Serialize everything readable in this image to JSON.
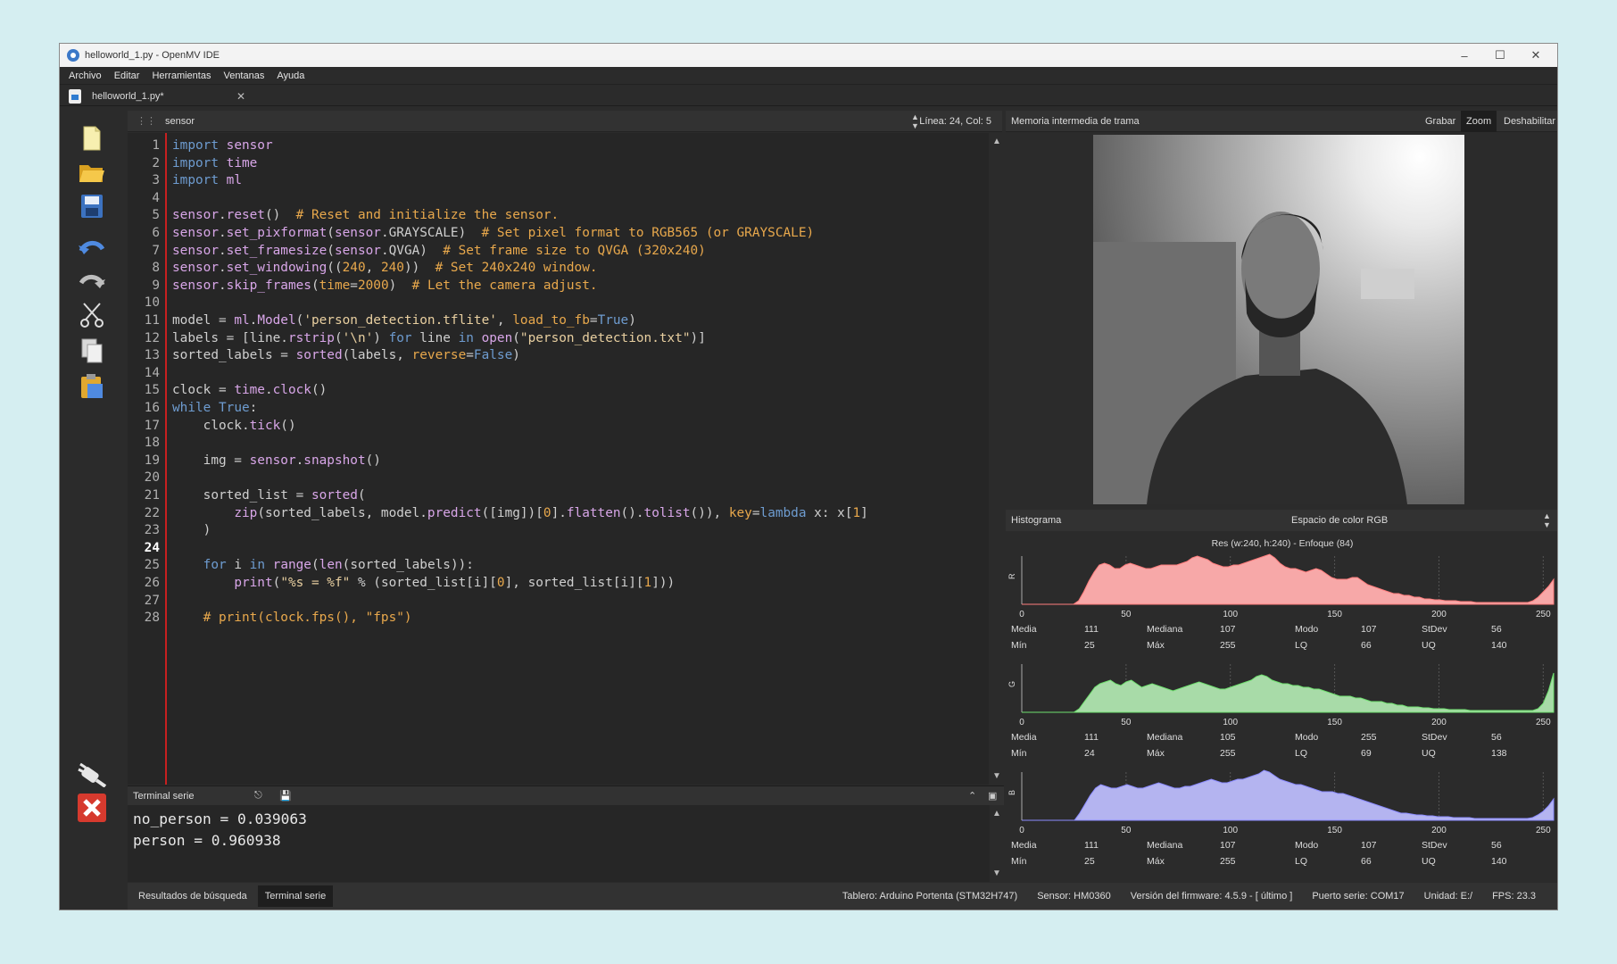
{
  "window": {
    "title": "helloworld_1.py - OpenMV IDE"
  },
  "menu": [
    "Archivo",
    "Editar",
    "Herramientas",
    "Ventanas",
    "Ayuda"
  ],
  "tab": {
    "label": "helloworld_1.py*"
  },
  "editor": {
    "header_name": "sensor",
    "cursor_pos": "Línea: 24, Col: 5",
    "current_line": 24,
    "line_numbers": [
      "1",
      "2",
      "3",
      "4",
      "5",
      "6",
      "7",
      "8",
      "9",
      "10",
      "11",
      "12",
      "13",
      "14",
      "15",
      "16",
      "17",
      "18",
      "19",
      "20",
      "21",
      "22",
      "23",
      "24",
      "25",
      "26",
      "27",
      "28"
    ],
    "lines": [
      "import sensor",
      "import time",
      "import ml",
      "",
      "sensor.reset()  # Reset and initialize the sensor.",
      "sensor.set_pixformat(sensor.GRAYSCALE)  # Set pixel format to RGB565 (or GRAYSCALE)",
      "sensor.set_framesize(sensor.QVGA)  # Set frame size to QVGA (320x240)",
      "sensor.set_windowing((240, 240))  # Set 240x240 window.",
      "sensor.skip_frames(time=2000)  # Let the camera adjust.",
      "",
      "model = ml.Model('person_detection.tflite', load_to_fb=True)",
      "labels = [line.rstrip('\\n') for line in open(\"person_detection.txt\")]",
      "sorted_labels = sorted(labels, reverse=False)",
      "",
      "clock = time.clock()",
      "while True:",
      "    clock.tick()",
      "",
      "    img = sensor.snapshot()",
      "",
      "    sorted_list = sorted(",
      "        zip(sorted_labels, model.predict([img])[0].flatten().tolist()), key=lambda x: x[1]",
      "    )",
      "",
      "    for i in range(len(sorted_labels)):",
      "        print(\"%s = %f\" % (sorted_list[i][0], sorted_list[i][1]))",
      "",
      "    # print(clock.fps(), \"fps\")"
    ]
  },
  "terminal": {
    "title": "Terminal serie",
    "lines": [
      "no_person = 0.039063",
      "person = 0.960938"
    ]
  },
  "bottom_tabs": [
    "Resultados de búsqueda",
    "Terminal serie"
  ],
  "status": {
    "board": "Tablero: Arduino Portenta (STM32H747)",
    "sensor": "Sensor: HM0360",
    "firmware": "Versión del firmware: 4.5.9 - [ último ]",
    "port": "Puerto serie: COM17",
    "drive": "Unidad: E:/",
    "fps": "FPS: 23.3"
  },
  "framebuffer": {
    "title": "Memoria intermedia de trama",
    "buttons": [
      "Grabar",
      "Zoom",
      "Deshabilitar"
    ]
  },
  "histogram": {
    "title": "Histograma",
    "colorspace": "Espacio de color RGB",
    "info": "Res (w:240, h:240) - Enfoque (84)",
    "axis_ticks": [
      "0",
      "50",
      "100",
      "150",
      "200",
      "250"
    ],
    "stat_labels": [
      "Media",
      "Mediana",
      "Modo",
      "StDev",
      "Mín",
      "Máx",
      "LQ",
      "UQ"
    ],
    "channels": [
      {
        "name": "R",
        "color": "#f7a8a8",
        "stroke": "#ff7d7d",
        "stats": {
          "mean": "111",
          "median": "107",
          "mode": "107",
          "stdev": "56",
          "min": "25",
          "max": "255",
          "lq": "66",
          "uq": "140"
        },
        "profile": [
          0,
          0,
          0,
          0,
          0,
          0,
          0,
          0,
          0,
          0,
          0,
          4,
          14,
          26,
          36,
          44,
          46,
          44,
          40,
          40,
          44,
          46,
          44,
          42,
          40,
          40,
          42,
          44,
          44,
          44,
          44,
          46,
          48,
          52,
          54,
          52,
          50,
          46,
          44,
          42,
          42,
          44,
          44,
          46,
          48,
          50,
          52,
          54,
          56,
          52,
          46,
          42,
          40,
          40,
          38,
          36,
          38,
          40,
          38,
          34,
          30,
          28,
          28,
          28,
          30,
          30,
          26,
          22,
          20,
          18,
          16,
          14,
          12,
          12,
          10,
          10,
          8,
          8,
          6,
          6,
          5,
          5,
          4,
          4,
          4,
          3,
          3,
          3,
          2,
          2,
          2,
          2,
          2,
          2,
          2,
          2,
          2,
          2,
          2,
          4,
          8,
          14,
          20,
          28
        ]
      },
      {
        "name": "G",
        "color": "#a8dba8",
        "stroke": "#6fe06f",
        "stats": {
          "mean": "111",
          "median": "105",
          "mode": "255",
          "stdev": "56",
          "min": "24",
          "max": "255",
          "lq": "69",
          "uq": "138"
        },
        "profile": [
          0,
          0,
          0,
          0,
          0,
          0,
          0,
          0,
          0,
          0,
          0,
          4,
          12,
          20,
          28,
          32,
          34,
          36,
          32,
          30,
          34,
          36,
          32,
          28,
          30,
          32,
          30,
          28,
          26,
          24,
          26,
          28,
          30,
          32,
          34,
          32,
          30,
          28,
          26,
          26,
          28,
          30,
          32,
          34,
          36,
          40,
          42,
          40,
          36,
          34,
          32,
          32,
          30,
          30,
          28,
          28,
          26,
          26,
          24,
          22,
          20,
          18,
          18,
          18,
          16,
          16,
          14,
          12,
          12,
          12,
          10,
          10,
          8,
          8,
          6,
          6,
          6,
          5,
          5,
          4,
          4,
          4,
          3,
          3,
          3,
          3,
          2,
          2,
          2,
          2,
          2,
          2,
          2,
          2,
          2,
          2,
          2,
          2,
          2,
          4,
          10,
          24,
          44
        ]
      },
      {
        "name": "B",
        "color": "#b4b4f0",
        "stroke": "#8b8bff",
        "stats": {
          "mean": "111",
          "median": "107",
          "mode": "107",
          "stdev": "56",
          "min": "25",
          "max": "255",
          "lq": "66",
          "uq": "140"
        },
        "profile": [
          0,
          0,
          0,
          0,
          0,
          0,
          0,
          0,
          0,
          0,
          0,
          8,
          18,
          28,
          36,
          40,
          38,
          36,
          36,
          38,
          40,
          38,
          36,
          36,
          38,
          40,
          42,
          40,
          38,
          36,
          36,
          38,
          38,
          40,
          42,
          44,
          46,
          44,
          42,
          42,
          44,
          46,
          46,
          48,
          50,
          52,
          56,
          54,
          50,
          46,
          44,
          42,
          40,
          40,
          38,
          36,
          34,
          32,
          32,
          32,
          30,
          30,
          28,
          26,
          24,
          22,
          20,
          18,
          16,
          14,
          12,
          10,
          8,
          8,
          7,
          6,
          6,
          5,
          5,
          4,
          4,
          4,
          3,
          3,
          3,
          3,
          2,
          2,
          2,
          2,
          2,
          2,
          2,
          2,
          2,
          2,
          2,
          3,
          6,
          10,
          16,
          24
        ]
      }
    ]
  }
}
